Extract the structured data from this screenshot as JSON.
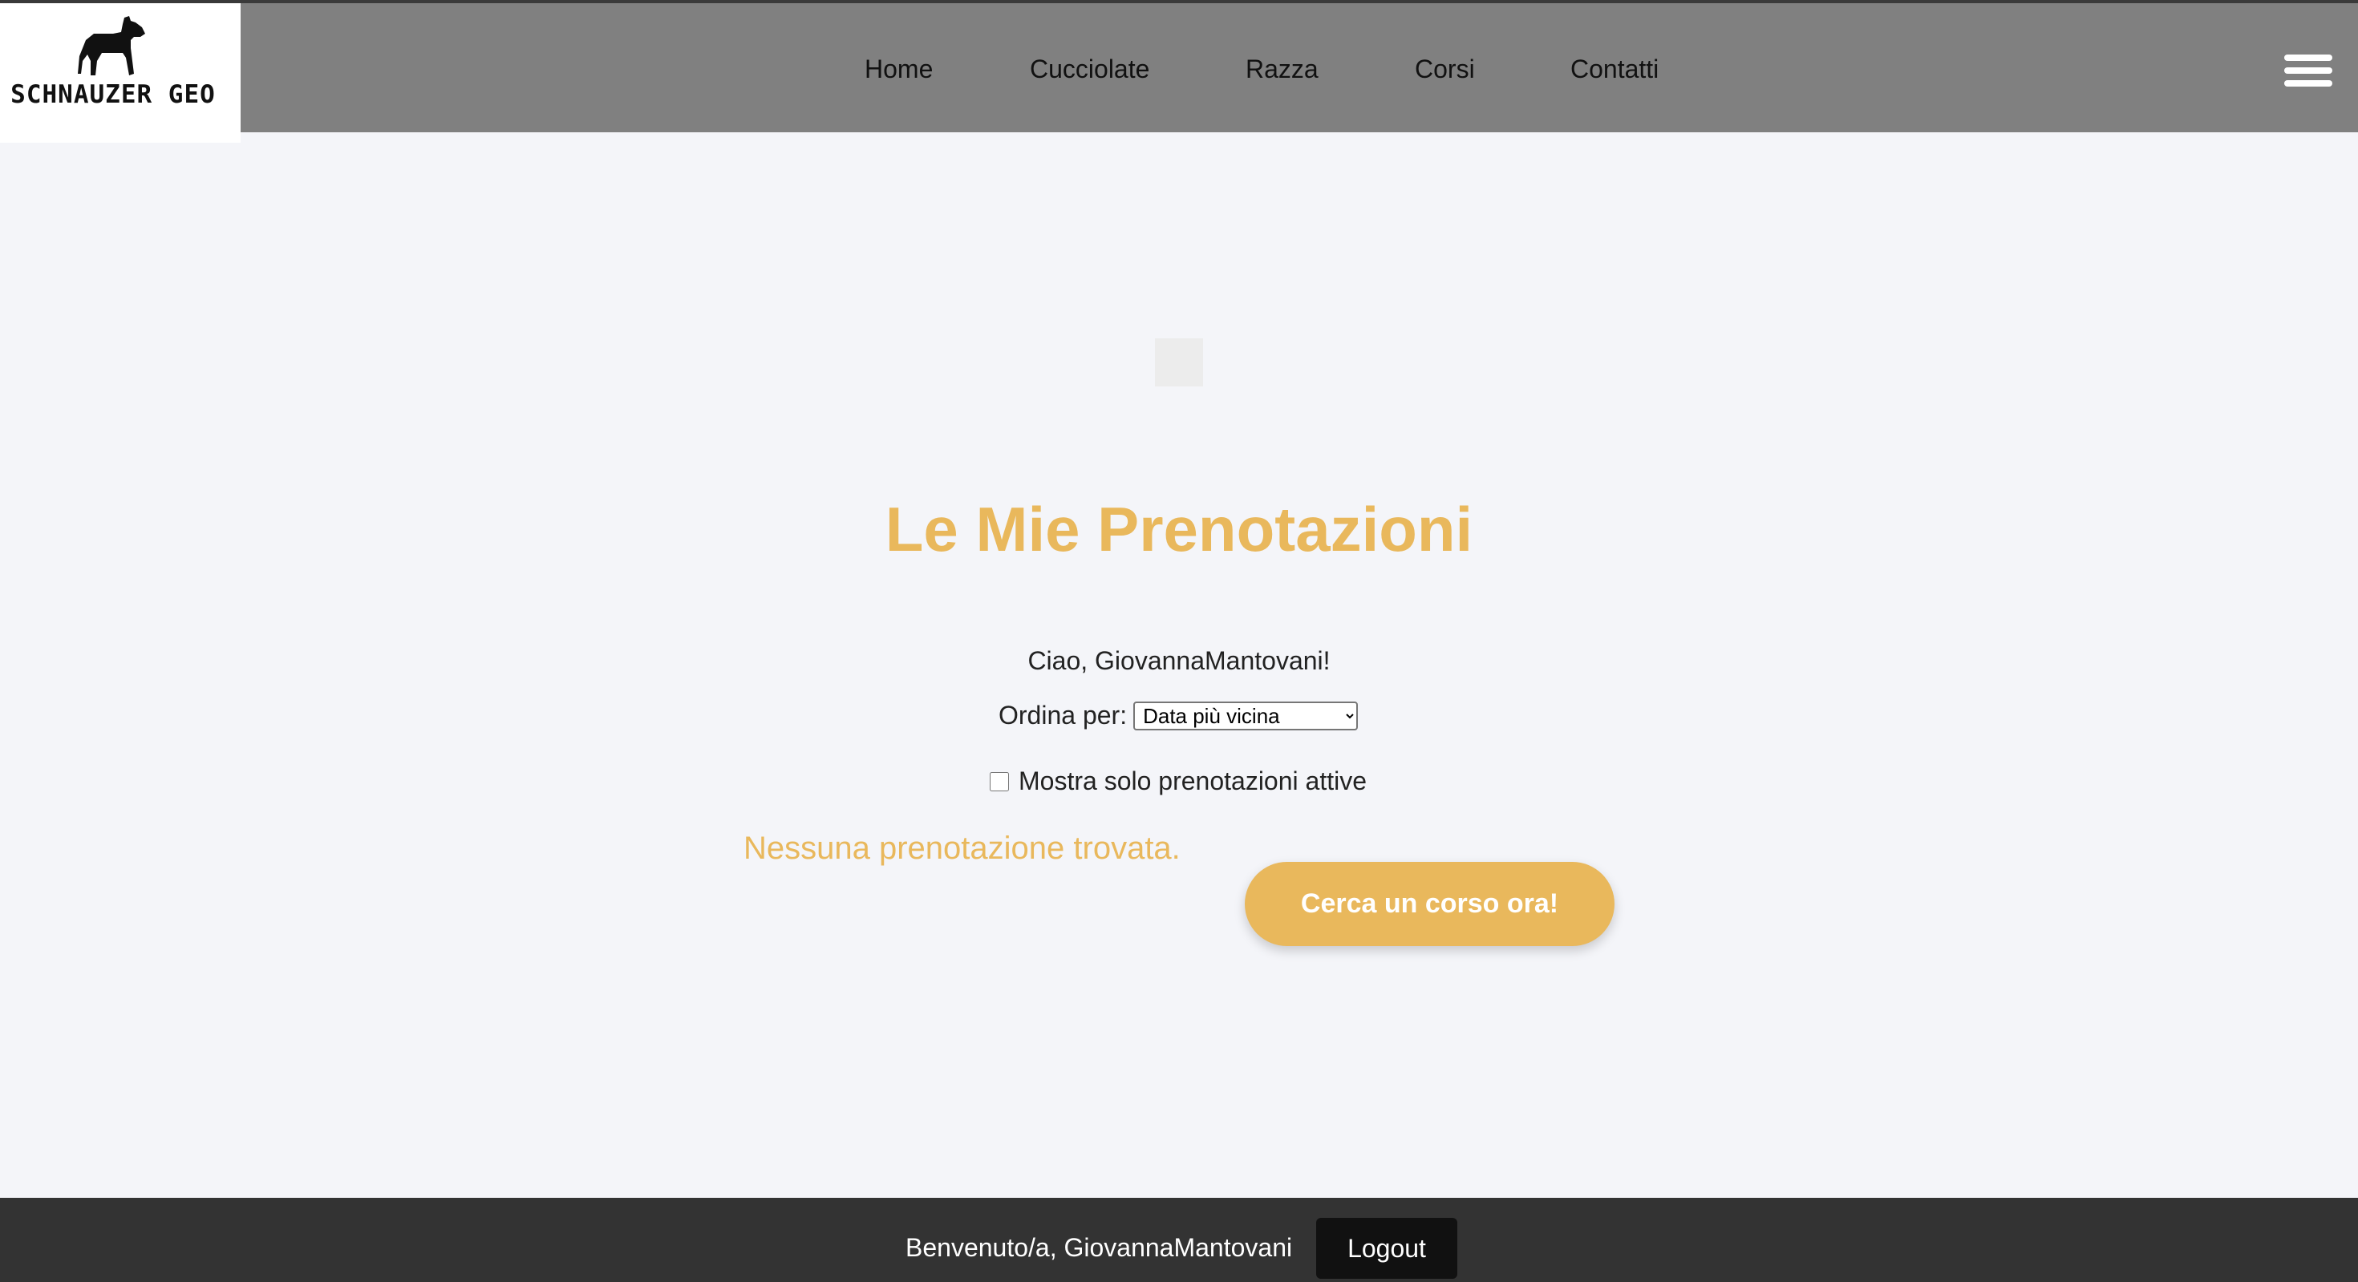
{
  "brand": {
    "logo_text": "SCHNAUZER GEO",
    "logo_icon": "schnauzer-dog-icon"
  },
  "nav": {
    "items": [
      {
        "label": "Home"
      },
      {
        "label": "Cucciolate"
      },
      {
        "label": "Razza"
      },
      {
        "label": "Corsi"
      },
      {
        "label": "Contatti"
      }
    ],
    "menu_icon": "hamburger-menu-icon"
  },
  "main": {
    "title": "Le Mie Prenotazioni",
    "greeting": "Ciao, GiovannaMantovani!",
    "sort_label": "Ordina per:",
    "sort_selected": "Data più vicina",
    "active_only_label": "Mostra solo prenotazioni attive",
    "active_only_checked": false,
    "empty_message": "Nessuna prenotazione trovata.",
    "cta_label": "Cerca un corso ora!"
  },
  "footer": {
    "welcome": "Benvenuto/a, GiovannaMantovani",
    "logout_label": "Logout"
  },
  "colors": {
    "accent": "#e9b85c",
    "header_bg": "#808080",
    "footer_bg": "#333333",
    "page_bg": "#f4f5f9"
  }
}
